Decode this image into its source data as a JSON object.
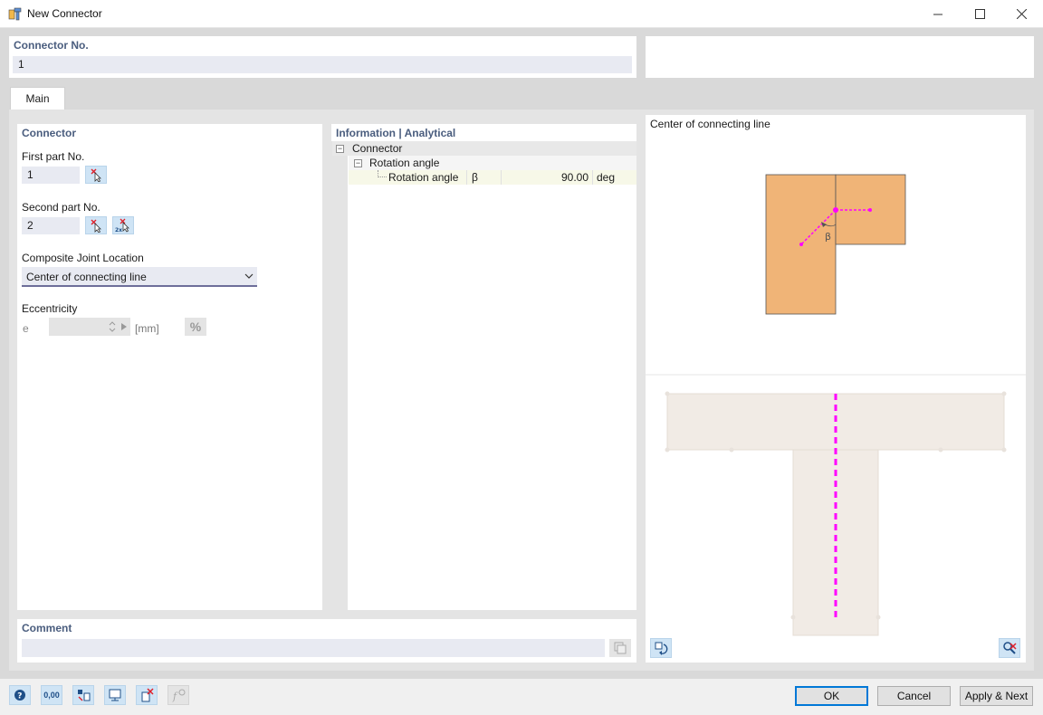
{
  "window": {
    "title": "New Connector"
  },
  "connector_no": {
    "label": "Connector No.",
    "value": "1"
  },
  "tabs": [
    {
      "label": "Main"
    }
  ],
  "connector": {
    "section_title": "Connector",
    "first_part": {
      "label": "First part No.",
      "value": "1"
    },
    "second_part": {
      "label": "Second part No.",
      "value": "2"
    },
    "composite_location": {
      "label": "Composite Joint Location",
      "selected": "Center of connecting line"
    },
    "eccentricity": {
      "label": "Eccentricity",
      "symbol": "e",
      "value": "",
      "unit": "[mm]",
      "percent_label": "%"
    }
  },
  "info": {
    "section_title": "Information | Analytical",
    "tree": {
      "root": "Connector",
      "group": "Rotation angle",
      "row": {
        "name": "Rotation angle",
        "symbol": "β",
        "value": "90.00",
        "unit": "deg"
      }
    }
  },
  "preview": {
    "title": "Center of connecting line",
    "beta_label": "β",
    "colors": {
      "part": "#f0b477",
      "line": "#ff00ff",
      "ghost": "#f1ebe5"
    }
  },
  "comment": {
    "label": "Comment",
    "value": ""
  },
  "toolbar_icons": [
    "help-icon",
    "units-icon",
    "display-properties-icon",
    "view-icon",
    "delete-icon",
    "formula-icon"
  ],
  "units_icon_text": "0,00",
  "buttons": {
    "ok": "OK",
    "cancel": "Cancel",
    "apply_next": "Apply & Next"
  }
}
